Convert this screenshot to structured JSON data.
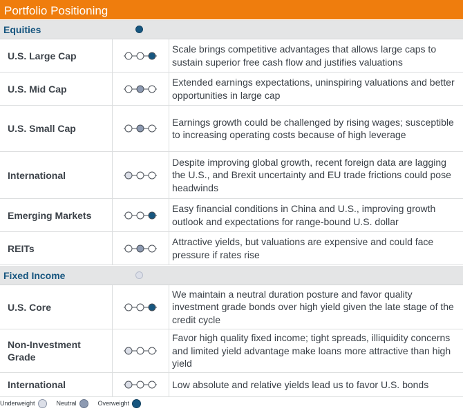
{
  "title": "Portfolio Positioning",
  "colors": {
    "header": "#ef7d0d",
    "section_text": "#16557f",
    "underweight": "#dcdfe8",
    "neutral": "#8d9ab2",
    "overweight": "#16567f"
  },
  "sections": [
    {
      "label": "Equities",
      "overall": "overweight",
      "rows": [
        {
          "name": "U.S. Large Cap",
          "position": "overweight",
          "text": "Scale brings competitive advantages that allows large caps to sustain superior free cash flow and justifies valuations"
        },
        {
          "name": "U.S. Mid Cap",
          "position": "neutral",
          "text": "Extended earnings expectations, uninspiring valuations and better opportunities in large cap"
        },
        {
          "name": "U.S. Small Cap",
          "position": "neutral",
          "text": "Earnings growth could be challenged by rising wages; susceptible to increasing operating costs because of high leverage"
        },
        {
          "name": "International",
          "position": "underweight",
          "text": "Despite improving global growth, recent foreign data are lagging the U.S., and Brexit uncertainty and EU trade frictions could pose headwinds"
        },
        {
          "name": "Emerging Markets",
          "position": "overweight",
          "text": "Easy financial conditions in China and U.S., improving growth outlook and expectations for range-bound U.S. dollar"
        },
        {
          "name": "REITs",
          "position": "neutral",
          "text": "Attractive yields, but valuations are expensive and could face pressure if rates rise"
        }
      ]
    },
    {
      "label": "Fixed Income",
      "overall": "underweight",
      "rows": [
        {
          "name": "U.S. Core",
          "position": "overweight",
          "text": "We maintain a neutral duration posture and favor quality investment grade bonds over high yield given the late stage of the credit cycle"
        },
        {
          "name": "Non-Investment Grade",
          "position": "underweight",
          "text": "Favor high quality fixed income; tight spreads, illiquidity concerns and limited yield advantage make loans more attractive than high yield"
        },
        {
          "name": "International",
          "position": "underweight",
          "text": "Low absolute and relative yields lead us to favor U.S. bonds"
        }
      ]
    }
  ],
  "legend": {
    "underweight": "Underweight",
    "neutral": "Neutral",
    "overweight": "Overweight"
  }
}
